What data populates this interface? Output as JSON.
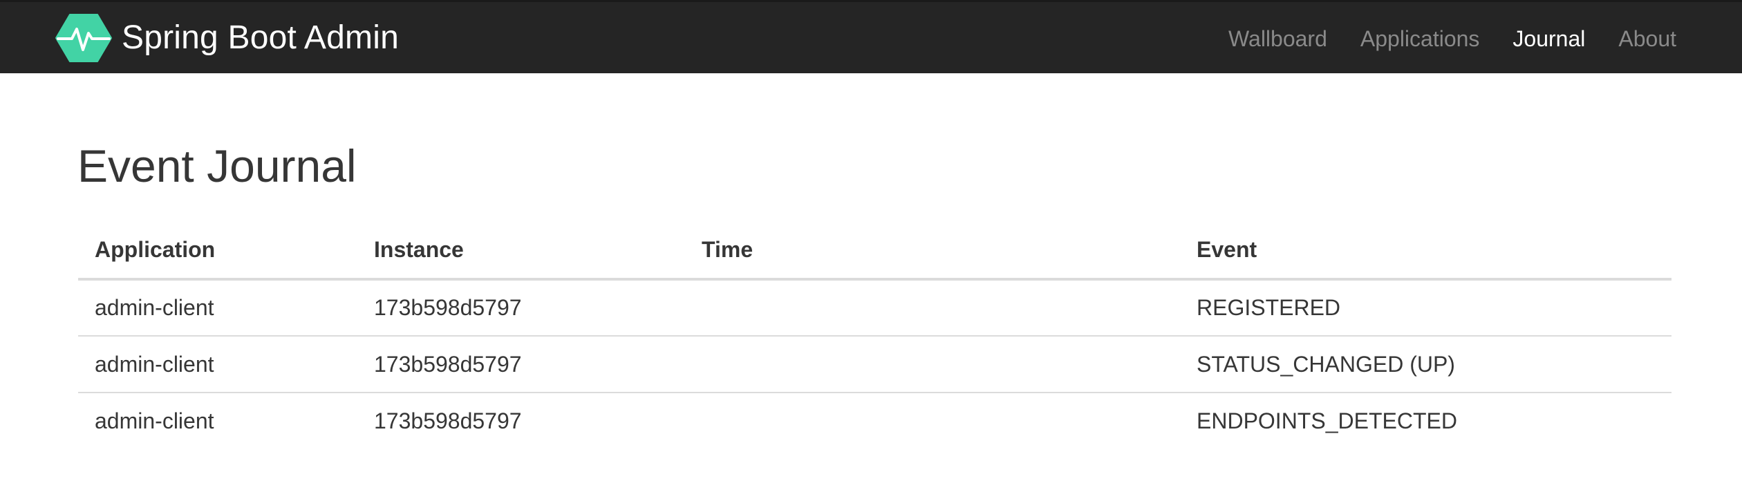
{
  "navbar": {
    "brand_name": "Spring Boot Admin",
    "logo_icon": "heartbeat-hexagon-icon",
    "logo_color": "#42d3a5",
    "items": [
      {
        "label": "Wallboard",
        "active": false
      },
      {
        "label": "Applications",
        "active": false
      },
      {
        "label": "Journal",
        "active": true
      },
      {
        "label": "About",
        "active": false
      }
    ]
  },
  "main": {
    "title": "Event Journal",
    "table": {
      "columns": [
        "Application",
        "Instance",
        "Time",
        "Event"
      ],
      "rows": [
        {
          "application": "admin-client",
          "instance": "173b598d5797",
          "time": "",
          "event": "REGISTERED"
        },
        {
          "application": "admin-client",
          "instance": "173b598d5797",
          "time": "",
          "event": "STATUS_CHANGED (UP)"
        },
        {
          "application": "admin-client",
          "instance": "173b598d5797",
          "time": "",
          "event": "ENDPOINTS_DETECTED"
        }
      ]
    }
  }
}
